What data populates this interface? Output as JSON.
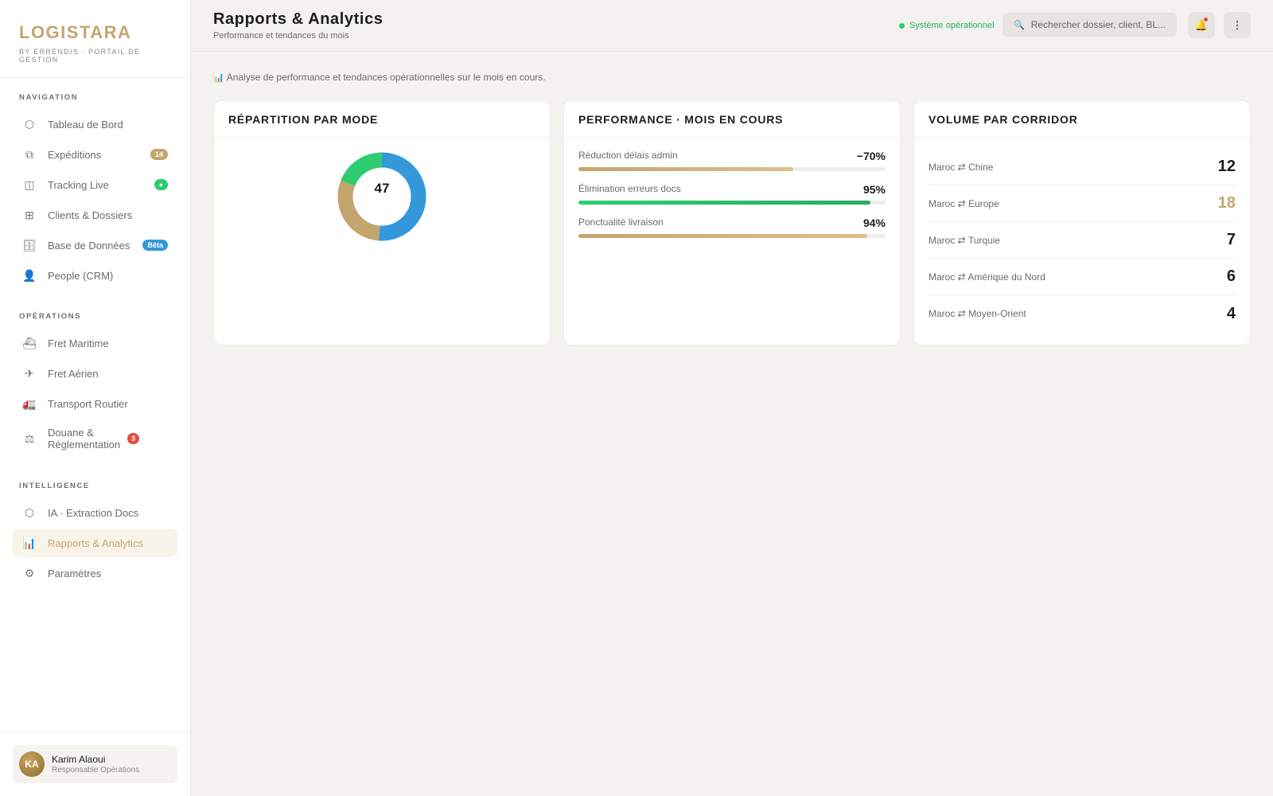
{
  "brand": {
    "name": "LOGISTARA",
    "subtitle": "BY ERRENDIS · PORTAIL DE GESTION"
  },
  "sidebar": {
    "navigation": {
      "title": "NAVIGATION",
      "items": [
        {
          "icon": "hexagon-icon",
          "label": "Tableau de Bord"
        },
        {
          "icon": "layers-icon",
          "label": "Expéditions",
          "badge": "14"
        },
        {
          "icon": "map-icon",
          "label": "Tracking Live",
          "badge": "●"
        },
        {
          "icon": "grid-icon",
          "label": "Clients & Dossiers"
        },
        {
          "icon": "database-icon",
          "label": "Base de Données",
          "badge": "Bêta"
        },
        {
          "icon": "person-icon",
          "label": "People (CRM)"
        }
      ]
    },
    "operations": {
      "title": "OPÉRATIONS",
      "items": [
        {
          "icon": "ship-icon",
          "label": "Fret Maritime"
        },
        {
          "icon": "plane-icon",
          "label": "Fret Aérien"
        },
        {
          "icon": "truck-icon",
          "label": "Transport Routier"
        },
        {
          "icon": "scales-icon",
          "label": "Douane & Réglementation",
          "badge": "3"
        }
      ]
    },
    "intelligence": {
      "title": "INTELLIGENCE",
      "items": [
        {
          "icon": "hexagon-icon",
          "label": "IA · Extraction Docs"
        },
        {
          "icon": "bar-chart-icon",
          "label": "Rapports & Analytics",
          "active": true
        },
        {
          "icon": "gear-icon",
          "label": "Paramètres"
        }
      ]
    },
    "user": {
      "initials": "KA",
      "name": "Karim Alaoui",
      "role": "Responsable Opérations"
    }
  },
  "header": {
    "title": "Rapports & Analytics",
    "subtitle": "Performance et tendances du mois",
    "status": "Système opérationnel",
    "search_placeholder": "Rechercher dossier, client, BL..."
  },
  "intro": "Analyse de performance et tendances opérationnelles sur le mois en cours.",
  "cards": {
    "mode": {
      "title": "RÉPARTITION PAR MODE",
      "total": "47",
      "segments": [
        {
          "value": 24,
          "color": "#3498db"
        },
        {
          "value": 14,
          "color": "#c5a56e"
        },
        {
          "value": 9,
          "color": "#2ecc71"
        }
      ]
    },
    "performance": {
      "title": "PERFORMANCE · MOIS EN COURS",
      "items": [
        {
          "label": "Réduction délais admin",
          "value": "−70%",
          "level": 70,
          "color": "gold"
        },
        {
          "label": "Élimination erreurs docs",
          "value": "95%",
          "level": 95,
          "color": "green"
        },
        {
          "label": "Ponctualité livraison",
          "value": "94%",
          "level": 94,
          "color": "gold"
        }
      ]
    },
    "corridor": {
      "title": "VOLUME PAR CORRIDOR",
      "items": [
        {
          "label": "Maroc ⇄ Chine",
          "value": "12"
        },
        {
          "label": "Maroc ⇄ Europe",
          "value": "18",
          "highlight": true
        },
        {
          "label": "Maroc ⇄ Turquie",
          "value": "7"
        },
        {
          "label": "Maroc ⇄ Amérique du Nord",
          "value": "6"
        },
        {
          "label": "Maroc ⇄ Moyen-Orient",
          "value": "4"
        }
      ]
    }
  }
}
